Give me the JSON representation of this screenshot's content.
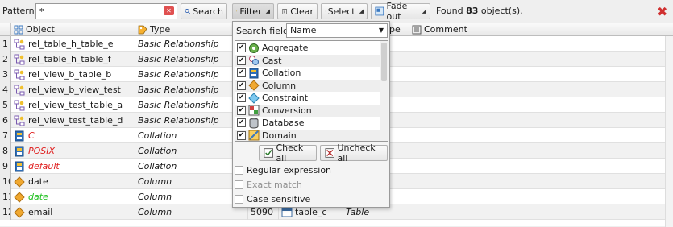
{
  "toolbar": {
    "pattern_label": "Pattern:",
    "pattern_value": "*",
    "search_label": "Search",
    "filter_label": "Filter",
    "clear_label": "Clear",
    "select_label": "Select",
    "fadeout_label": "Fade out",
    "found_prefix": "Found",
    "found_count": "83",
    "found_suffix": "object(s)."
  },
  "grid": {
    "headers": {
      "object": "Object",
      "type": "Type",
      "type_partial": "pe",
      "comment": "Comment"
    },
    "rows": [
      {
        "num": "1",
        "name": "rel_table_h_table_e",
        "type": "Basic Relationship",
        "icon": "relationship-icon",
        "style": ""
      },
      {
        "num": "2",
        "name": "rel_table_h_table_f",
        "type": "Basic Relationship",
        "icon": "relationship-icon",
        "style": ""
      },
      {
        "num": "3",
        "name": "rel_view_b_table_b",
        "type": "Basic Relationship",
        "icon": "relationship-icon",
        "style": ""
      },
      {
        "num": "4",
        "name": "rel_view_b_view_test",
        "type": "Basic Relationship",
        "icon": "relationship-icon",
        "style": ""
      },
      {
        "num": "5",
        "name": "rel_view_test_table_a",
        "type": "Basic Relationship",
        "icon": "relationship-icon",
        "style": ""
      },
      {
        "num": "6",
        "name": "rel_view_test_table_d",
        "type": "Basic Relationship",
        "icon": "relationship-icon",
        "style": ""
      },
      {
        "num": "7",
        "name": "C",
        "type": "Collation",
        "icon": "collation-icon",
        "style": "red"
      },
      {
        "num": "8",
        "name": "POSIX",
        "type": "Collation",
        "icon": "collation-icon",
        "style": "red"
      },
      {
        "num": "9",
        "name": "default",
        "type": "Collation",
        "icon": "collation-icon",
        "style": "red"
      },
      {
        "num": "10",
        "name": "date",
        "type": "Column",
        "icon": "column-icon",
        "style": ""
      },
      {
        "num": "11",
        "name": "date",
        "type": "Column",
        "icon": "column-icon",
        "style": "green"
      },
      {
        "num": "12",
        "name": "email",
        "type": "Column",
        "icon": "column-icon",
        "style": "",
        "id": "5090",
        "parent": "table_c",
        "parent_type": "Table"
      }
    ]
  },
  "filter_popup": {
    "search_field_label": "Search field:",
    "search_field_value": "Name",
    "items": [
      {
        "label": "Aggregate",
        "checked": true,
        "icon": "aggregate-icon"
      },
      {
        "label": "Cast",
        "checked": true,
        "icon": "cast-icon"
      },
      {
        "label": "Collation",
        "checked": true,
        "icon": "collation-icon"
      },
      {
        "label": "Column",
        "checked": true,
        "icon": "column-icon"
      },
      {
        "label": "Constraint",
        "checked": true,
        "icon": "constraint-icon"
      },
      {
        "label": "Conversion",
        "checked": true,
        "icon": "conversion-icon"
      },
      {
        "label": "Database",
        "checked": true,
        "icon": "database-icon"
      },
      {
        "label": "Domain",
        "checked": true,
        "icon": "domain-icon"
      }
    ],
    "check_all_label": "Check all",
    "uncheck_all_label": "Uncheck all",
    "regex_label": "Regular expression",
    "exact_label": "Exact match",
    "case_label": "Case sensitive"
  },
  "colors": {
    "invalid": "#e02020",
    "new": "#20c020",
    "close": "#d03030"
  }
}
